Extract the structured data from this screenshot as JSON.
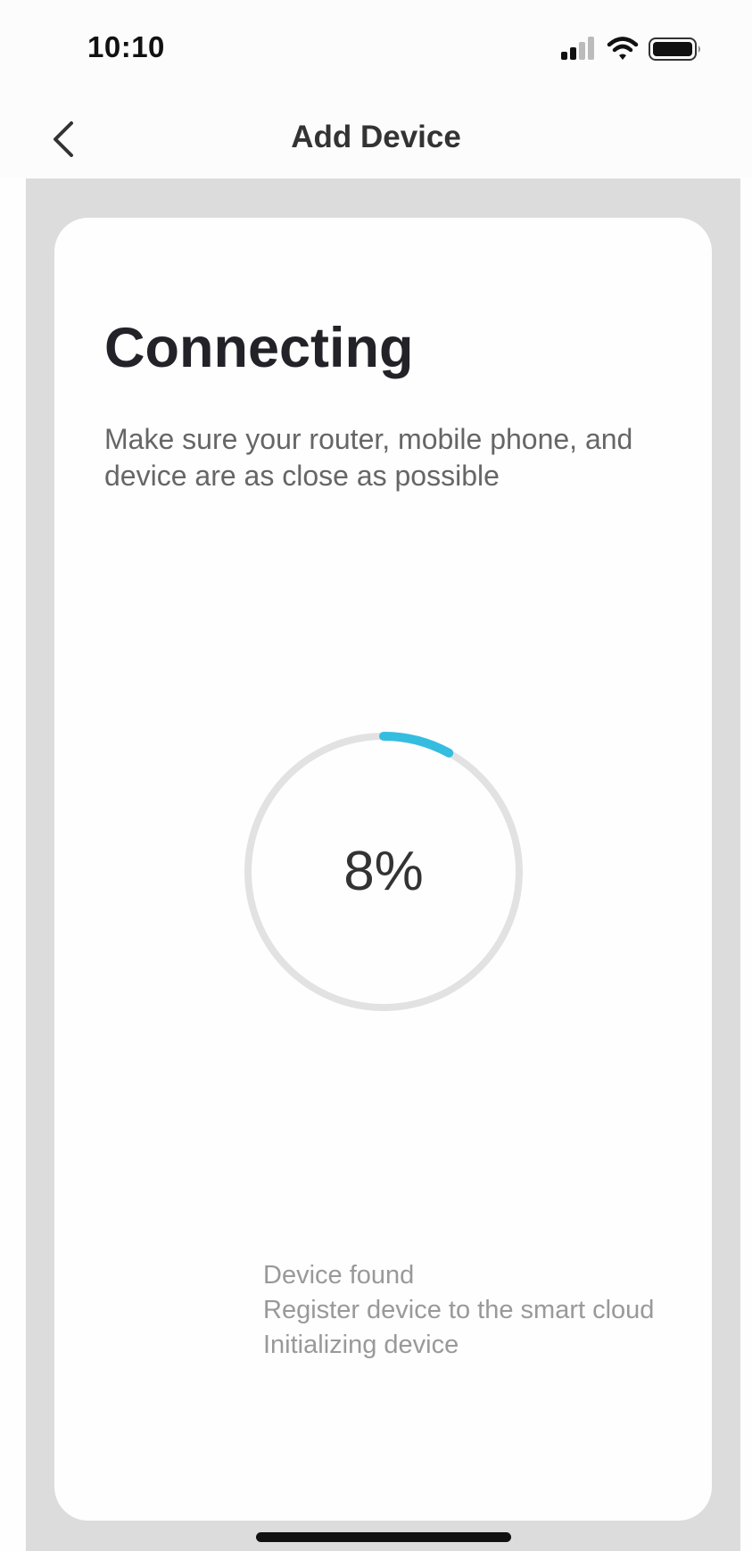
{
  "status_bar": {
    "time": "10:10",
    "icons": [
      "signal-icon",
      "wifi-icon",
      "battery-icon"
    ]
  },
  "nav": {
    "title": "Add Device",
    "back_icon": "chevron-left-icon"
  },
  "main": {
    "heading": "Connecting",
    "subtitle": "Make sure your router, mobile phone, and device are as close as possible",
    "progress": {
      "label": "8%",
      "value_percent": 8
    },
    "steps": [
      "Device found",
      "Register device to the smart cloud",
      "Initializing device"
    ]
  },
  "colors": {
    "accent": "#35bde0",
    "track": "#e2e2e2",
    "background": "#dcdcdc",
    "card": "#fefefe"
  }
}
